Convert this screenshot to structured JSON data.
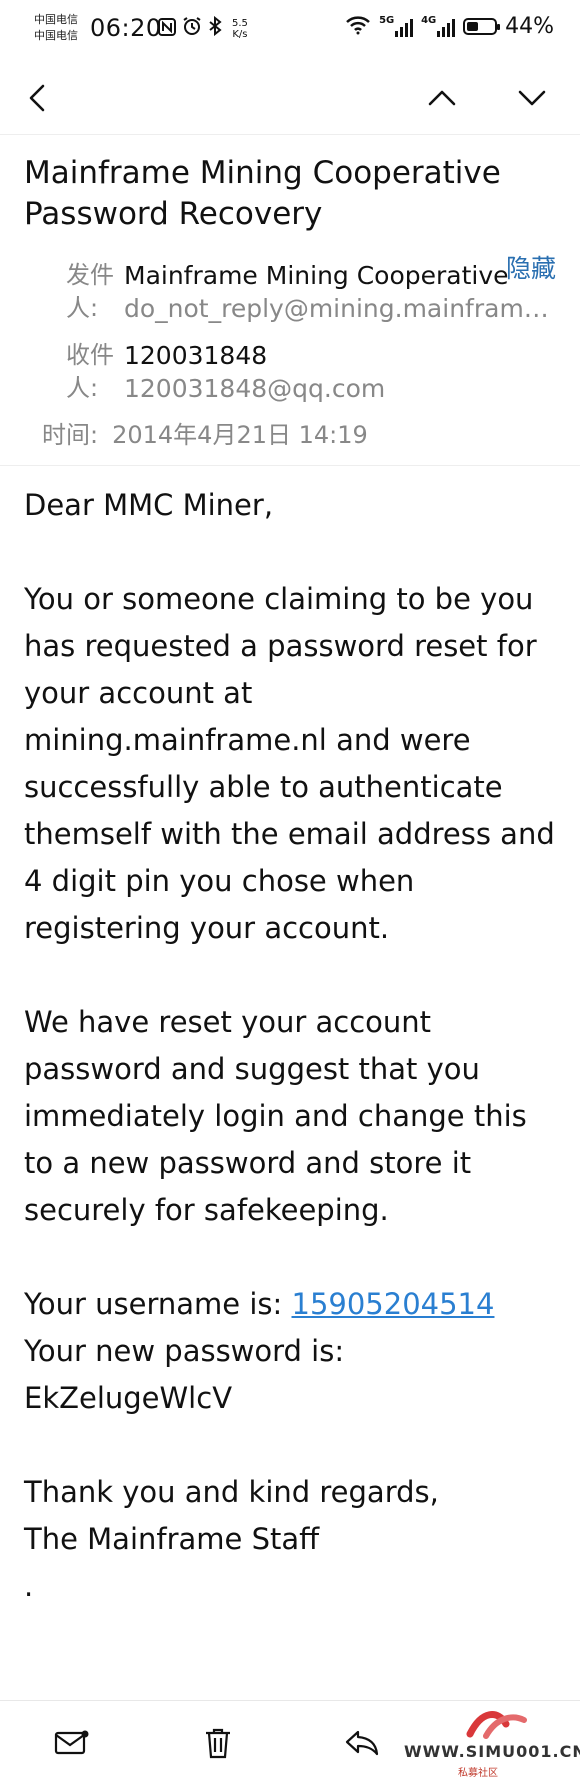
{
  "status_bar": {
    "carrier_line1": "中国电信",
    "carrier_line2": "中国电信",
    "time": "06:20",
    "net_speed_top": "5.5",
    "net_speed_bottom": "K/s",
    "signal1_label": "5G",
    "signal2_label": "4G",
    "battery_level": 0.44,
    "battery_text": "44%"
  },
  "email": {
    "subject": "Mainframe Mining Cooperative Password Recovery",
    "from_label": "发件人:",
    "from_name": "Mainframe Mining Cooperative",
    "from_address": "do_not_reply@mining.mainframe.nl",
    "to_label": "收件人:",
    "to_name": "120031848",
    "to_address": "120031848@qq.com",
    "hide_label": "隐藏",
    "time_label": "时间:",
    "time_value": "2014年4月21日 14:19"
  },
  "body": {
    "greeting": "Dear MMC Miner,",
    "paragraph1": "You or someone claiming to be you has requested a password reset for your account at mining.mainframe.nl and were successfully able to authenticate themself with the email address and 4 digit pin you chose when registering your account.",
    "paragraph2": "We have reset your account password and suggest that you immediately login and change this to a new password and store it securely for safekeeping.",
    "username_label": "Your username is:",
    "username_value": "15905204514",
    "password_label": "Your new password is:",
    "password_value": "EkZelugeWlcV",
    "closing": "Thank you and kind regards,",
    "signature": "The Mainframe Staff",
    "trailing": "."
  },
  "watermark": {
    "text": "WWW.SIMU001.CN",
    "subtext": "私募社区"
  },
  "colors": {
    "accent": "#2a6fb0",
    "link": "#2a7fd1",
    "muted": "#888888"
  },
  "icons": [
    "back-arrow-icon",
    "chevron-up-icon",
    "chevron-down-icon",
    "mail-icon",
    "trash-icon",
    "reply-icon"
  ]
}
